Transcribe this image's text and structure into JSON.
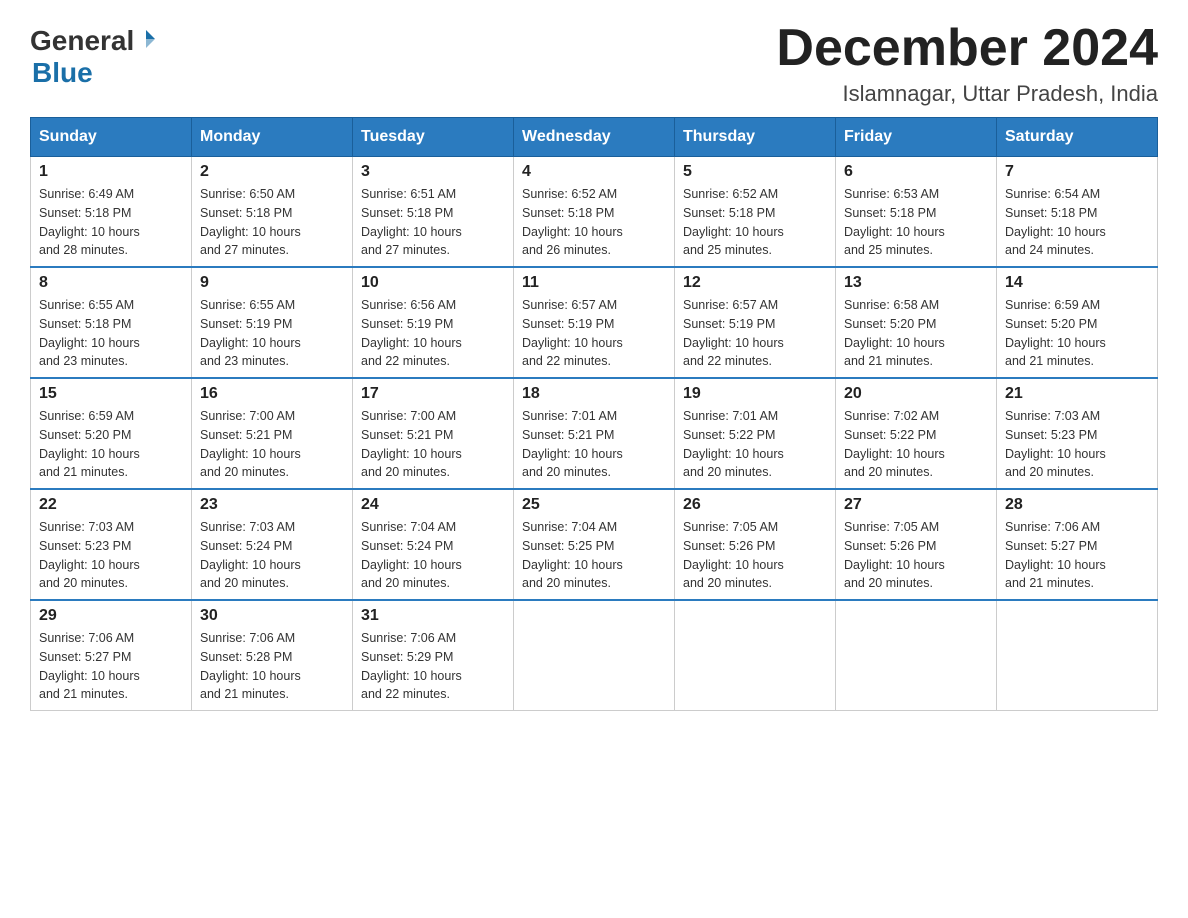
{
  "header": {
    "logo_general": "General",
    "logo_blue": "Blue",
    "month_title": "December 2024",
    "location": "Islamnagar, Uttar Pradesh, India"
  },
  "days_of_week": [
    "Sunday",
    "Monday",
    "Tuesday",
    "Wednesday",
    "Thursday",
    "Friday",
    "Saturday"
  ],
  "weeks": [
    [
      {
        "day": "1",
        "sunrise": "6:49 AM",
        "sunset": "5:18 PM",
        "daylight": "10 hours and 28 minutes."
      },
      {
        "day": "2",
        "sunrise": "6:50 AM",
        "sunset": "5:18 PM",
        "daylight": "10 hours and 27 minutes."
      },
      {
        "day": "3",
        "sunrise": "6:51 AM",
        "sunset": "5:18 PM",
        "daylight": "10 hours and 27 minutes."
      },
      {
        "day": "4",
        "sunrise": "6:52 AM",
        "sunset": "5:18 PM",
        "daylight": "10 hours and 26 minutes."
      },
      {
        "day": "5",
        "sunrise": "6:52 AM",
        "sunset": "5:18 PM",
        "daylight": "10 hours and 25 minutes."
      },
      {
        "day": "6",
        "sunrise": "6:53 AM",
        "sunset": "5:18 PM",
        "daylight": "10 hours and 25 minutes."
      },
      {
        "day": "7",
        "sunrise": "6:54 AM",
        "sunset": "5:18 PM",
        "daylight": "10 hours and 24 minutes."
      }
    ],
    [
      {
        "day": "8",
        "sunrise": "6:55 AM",
        "sunset": "5:18 PM",
        "daylight": "10 hours and 23 minutes."
      },
      {
        "day": "9",
        "sunrise": "6:55 AM",
        "sunset": "5:19 PM",
        "daylight": "10 hours and 23 minutes."
      },
      {
        "day": "10",
        "sunrise": "6:56 AM",
        "sunset": "5:19 PM",
        "daylight": "10 hours and 22 minutes."
      },
      {
        "day": "11",
        "sunrise": "6:57 AM",
        "sunset": "5:19 PM",
        "daylight": "10 hours and 22 minutes."
      },
      {
        "day": "12",
        "sunrise": "6:57 AM",
        "sunset": "5:19 PM",
        "daylight": "10 hours and 22 minutes."
      },
      {
        "day": "13",
        "sunrise": "6:58 AM",
        "sunset": "5:20 PM",
        "daylight": "10 hours and 21 minutes."
      },
      {
        "day": "14",
        "sunrise": "6:59 AM",
        "sunset": "5:20 PM",
        "daylight": "10 hours and 21 minutes."
      }
    ],
    [
      {
        "day": "15",
        "sunrise": "6:59 AM",
        "sunset": "5:20 PM",
        "daylight": "10 hours and 21 minutes."
      },
      {
        "day": "16",
        "sunrise": "7:00 AM",
        "sunset": "5:21 PM",
        "daylight": "10 hours and 20 minutes."
      },
      {
        "day": "17",
        "sunrise": "7:00 AM",
        "sunset": "5:21 PM",
        "daylight": "10 hours and 20 minutes."
      },
      {
        "day": "18",
        "sunrise": "7:01 AM",
        "sunset": "5:21 PM",
        "daylight": "10 hours and 20 minutes."
      },
      {
        "day": "19",
        "sunrise": "7:01 AM",
        "sunset": "5:22 PM",
        "daylight": "10 hours and 20 minutes."
      },
      {
        "day": "20",
        "sunrise": "7:02 AM",
        "sunset": "5:22 PM",
        "daylight": "10 hours and 20 minutes."
      },
      {
        "day": "21",
        "sunrise": "7:03 AM",
        "sunset": "5:23 PM",
        "daylight": "10 hours and 20 minutes."
      }
    ],
    [
      {
        "day": "22",
        "sunrise": "7:03 AM",
        "sunset": "5:23 PM",
        "daylight": "10 hours and 20 minutes."
      },
      {
        "day": "23",
        "sunrise": "7:03 AM",
        "sunset": "5:24 PM",
        "daylight": "10 hours and 20 minutes."
      },
      {
        "day": "24",
        "sunrise": "7:04 AM",
        "sunset": "5:24 PM",
        "daylight": "10 hours and 20 minutes."
      },
      {
        "day": "25",
        "sunrise": "7:04 AM",
        "sunset": "5:25 PM",
        "daylight": "10 hours and 20 minutes."
      },
      {
        "day": "26",
        "sunrise": "7:05 AM",
        "sunset": "5:26 PM",
        "daylight": "10 hours and 20 minutes."
      },
      {
        "day": "27",
        "sunrise": "7:05 AM",
        "sunset": "5:26 PM",
        "daylight": "10 hours and 20 minutes."
      },
      {
        "day": "28",
        "sunrise": "7:06 AM",
        "sunset": "5:27 PM",
        "daylight": "10 hours and 21 minutes."
      }
    ],
    [
      {
        "day": "29",
        "sunrise": "7:06 AM",
        "sunset": "5:27 PM",
        "daylight": "10 hours and 21 minutes."
      },
      {
        "day": "30",
        "sunrise": "7:06 AM",
        "sunset": "5:28 PM",
        "daylight": "10 hours and 21 minutes."
      },
      {
        "day": "31",
        "sunrise": "7:06 AM",
        "sunset": "5:29 PM",
        "daylight": "10 hours and 22 minutes."
      },
      null,
      null,
      null,
      null
    ]
  ],
  "labels": {
    "sunrise_prefix": "Sunrise: ",
    "sunset_prefix": "Sunset: ",
    "daylight_prefix": "Daylight: "
  }
}
